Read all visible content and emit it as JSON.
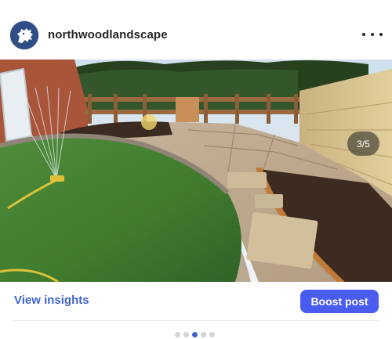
{
  "post": {
    "username": "northwoodlandscape",
    "avatar_icon": "lion-crest-icon",
    "more_icon": "more-horizontal-icon",
    "image_counter": "3/5",
    "carousel": {
      "total": 5,
      "active_index": 2
    }
  },
  "actions": {
    "insights_label": "View insights",
    "boost_label": "Boost post"
  },
  "colors": {
    "accent": "#3f64cf",
    "boost_button": "#4a5cf0",
    "avatar_bg": "#2f4e86"
  }
}
